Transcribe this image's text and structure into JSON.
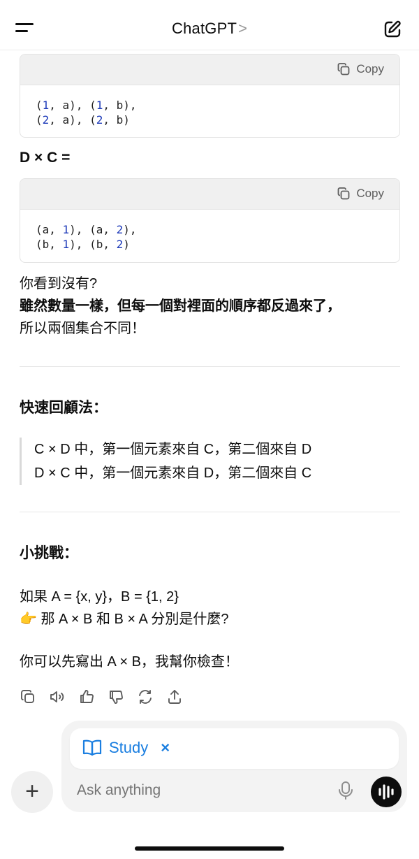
{
  "header": {
    "title": "ChatGPT",
    "chevron": ">"
  },
  "code_blocks": [
    {
      "copy_label": "Copy",
      "lines": [
        [
          [
            "(",
            ""
          ],
          [
            "1",
            "num"
          ],
          [
            ", a), (",
            ""
          ],
          [
            "1",
            "num"
          ],
          [
            ", b),",
            ""
          ]
        ],
        [
          [
            "(",
            ""
          ],
          [
            "2",
            "num"
          ],
          [
            ", a), (",
            ""
          ],
          [
            "2",
            "num"
          ],
          [
            ", b)",
            ""
          ]
        ]
      ]
    },
    {
      "copy_label": "Copy",
      "lines": [
        [
          [
            "(a, ",
            ""
          ],
          [
            "1",
            "num"
          ],
          [
            "), (a, ",
            ""
          ],
          [
            "2",
            "num"
          ],
          [
            "),",
            ""
          ]
        ],
        [
          [
            "(b, ",
            ""
          ],
          [
            "1",
            "num"
          ],
          [
            "), (b, ",
            ""
          ],
          [
            "2",
            "num"
          ],
          [
            ")",
            ""
          ]
        ]
      ]
    }
  ],
  "dxc_heading": "D × C =",
  "observe": {
    "line1": "你看到沒有?",
    "line2": "雖然數量一樣，但每一個對裡面的順序都反過來了，",
    "line3": "所以兩個集合不同！"
  },
  "review": {
    "heading": "快速回顧法：",
    "line1": "C × D 中，第一個元素來自 C，第二個來自 D",
    "line2": "D × C 中，第一個元素來自 D，第二個來自 C"
  },
  "challenge": {
    "heading": "小挑戰：",
    "line1": "如果 A = {x, y}，B = {1, 2}",
    "line2": "👉 那 A × B 和 B × A 分別是什麼?",
    "line3": "你可以先寫出 A × B，我幫你檢查！"
  },
  "composer": {
    "chip_label": "Study",
    "chip_close": "×",
    "placeholder": "Ask anything",
    "plus": "+"
  },
  "colors": {
    "accent": "#1a7ee0",
    "code_number": "#1c39b8"
  }
}
